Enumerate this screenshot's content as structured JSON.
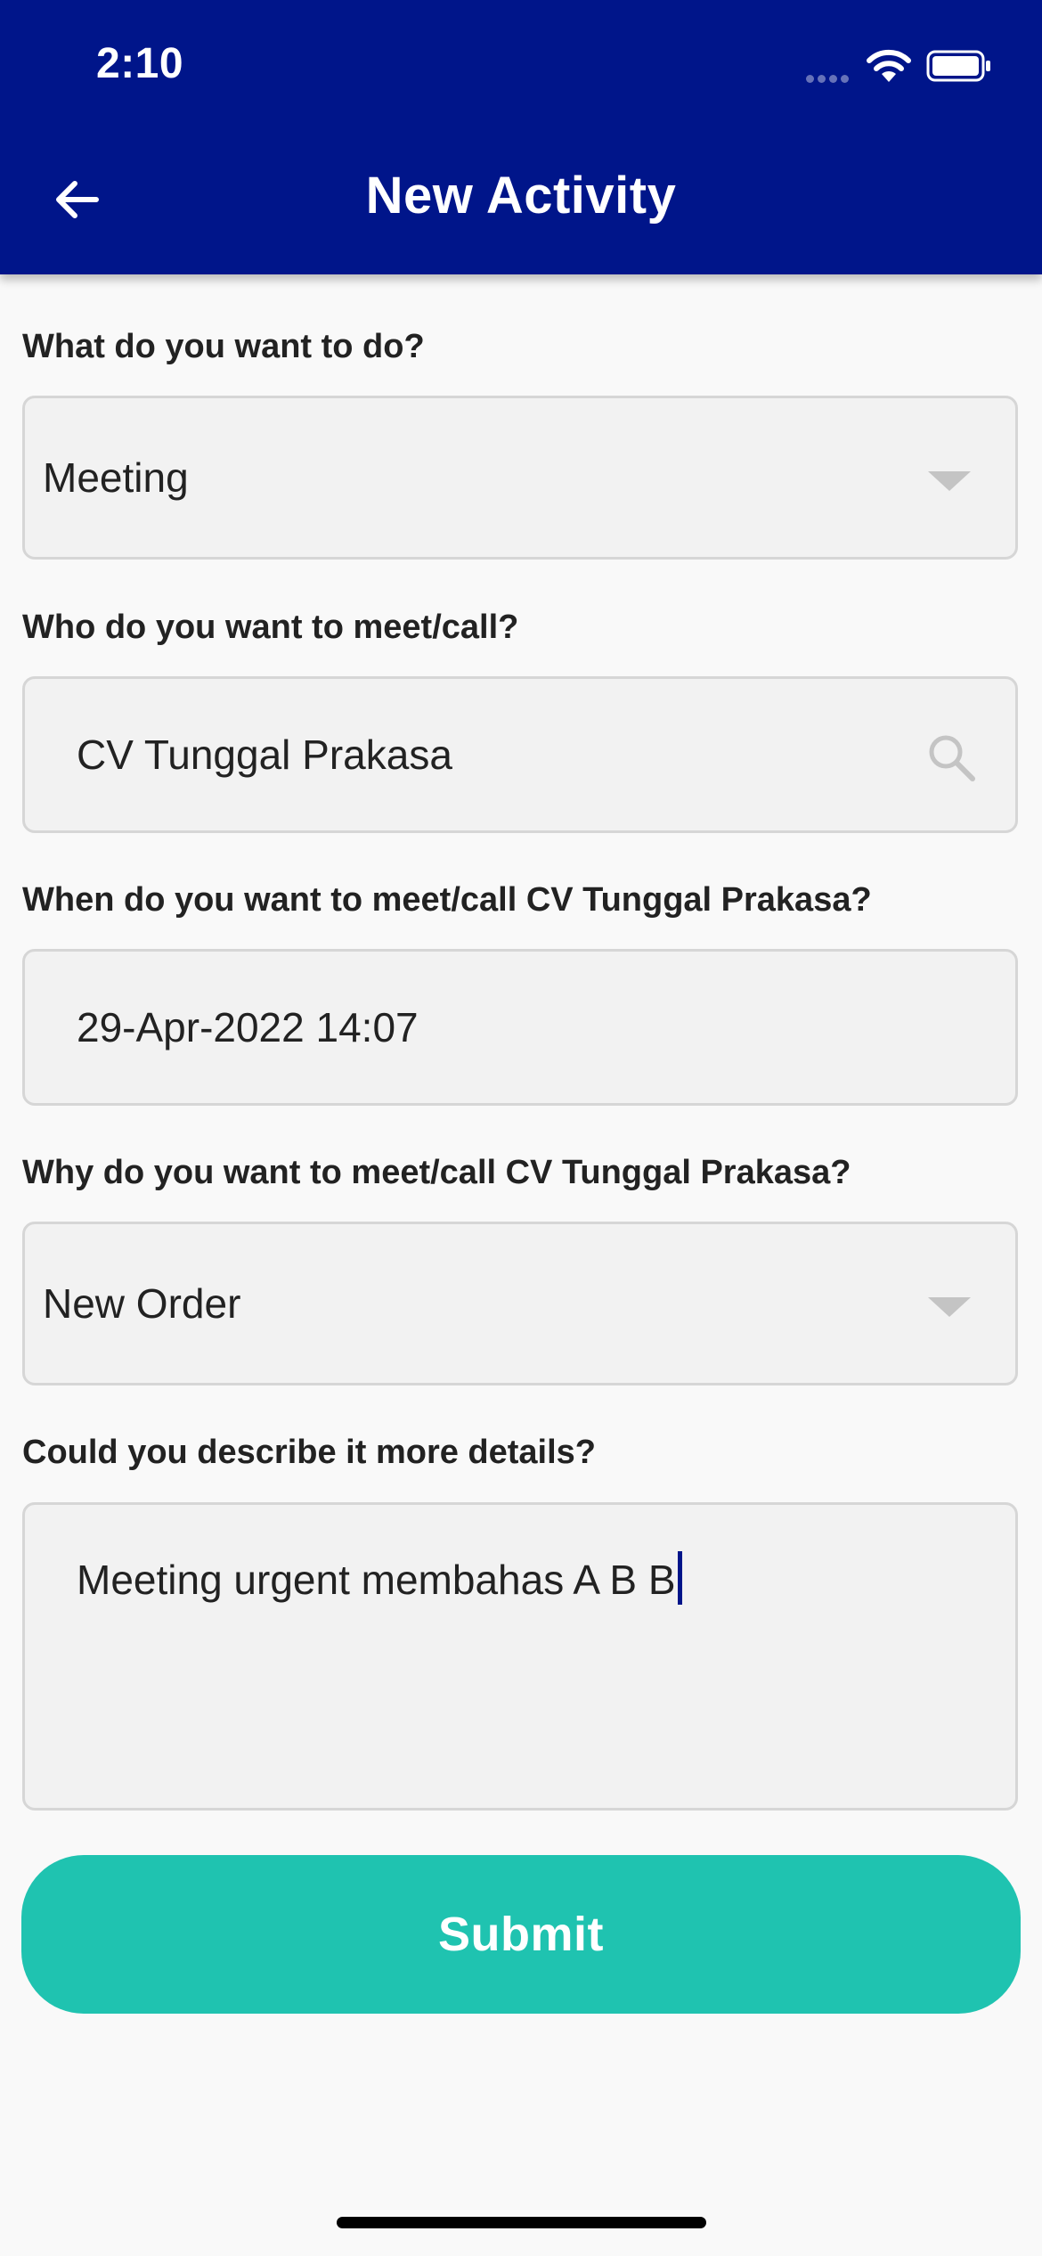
{
  "status_bar": {
    "time": "2:10"
  },
  "header": {
    "title": "New Activity",
    "back_icon": "arrow-left-icon"
  },
  "form": {
    "activity_type": {
      "label": "What do you want to do?",
      "value": "Meeting"
    },
    "contact": {
      "label": "Who do you want to meet/call?",
      "value": "CV Tunggal Prakasa",
      "icon": "search-icon"
    },
    "datetime": {
      "label": "When do you want to meet/call CV Tunggal Prakasa?",
      "value": "29-Apr-2022 14:07"
    },
    "purpose": {
      "label": "Why do you want to meet/call CV Tunggal Prakasa?",
      "value": "New Order"
    },
    "details": {
      "label": "Could you describe it more details?",
      "value": "Meeting urgent membahas A B B"
    },
    "submit_label": "Submit"
  },
  "colors": {
    "header_bg": "#00158a",
    "submit_bg": "#1fc3b0",
    "field_bg": "#f2f2f2",
    "page_bg": "#f9f9f9"
  }
}
